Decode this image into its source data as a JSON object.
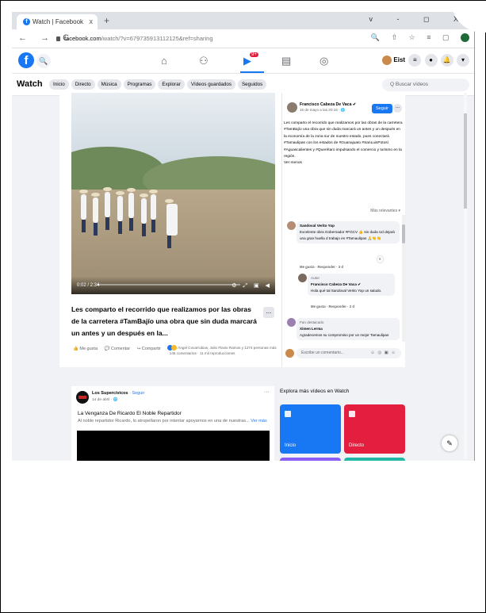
{
  "browser": {
    "tab_title": "Watch | Facebook",
    "tab_close": "x",
    "new_tab": "+",
    "window_controls": "v - ◻ X",
    "nav_buttons": "← → C",
    "url_host": "facebook.com",
    "url_path": "/watch/?v=679735913112125&ref=sharing",
    "extension_icons": "🔍 ⇧ ☆ ≡ ▢"
  },
  "fb_header": {
    "logo": "f",
    "search_icon": "🔍",
    "nav_badge": "9+",
    "profile_name": "Eist",
    "right_icons": [
      "≡",
      "●",
      "🔔",
      "▾"
    ]
  },
  "watch_bar": {
    "title": "Watch",
    "tabs": [
      "Inicio",
      "Directo",
      "Música",
      "Programas",
      "Explorar",
      "Vídeos guardados",
      "Seguidos"
    ],
    "search_placeholder": "Q Buscar vídeos"
  },
  "video": {
    "time": "0:02 / 2:34",
    "controls": "⚙ ⤢ ▣ ◀",
    "progress_fraction": 0.01,
    "title": "Les comparto el recorrido que realizamos por las obras de la carretera #TamBajío una obra que sin duda marcará un antes y un después en la...",
    "more_button": "...",
    "actions": {
      "like": "👍 Me gusta",
      "comment": "💬 Comentar",
      "share": "↪ Compartir"
    },
    "reactions_text": "Ángel Covarrubias, Julio Flavio Ramos y 1274 personas más · 145 comentarios · 11 mil reproducciones"
  },
  "panel": {
    "author_name": "Francisco Cabeza De Vaca ✔",
    "author_date": "16 de mayo a las 20:16 · 🌐",
    "follow_label": "Seguir",
    "dots": "...",
    "description": "Les comparto el recorrido que realizamos por las obras de la carretera #TamBajío una obra que sin duda marcará un antes y un después en la economía de la zona sur de nuestro estado, pues conectará #Tamaulipas con los estados de #Guanajuato #SanLuisPotosí #Aguascalientes y #Querétaro impulsando el comercio y turismo en la región.",
    "see_less": "Ver menos",
    "sort_label": "Más relevantes ▾",
    "comments": [
      {
        "name": "Sandoval Verito Yop",
        "text": "Excelente obra Gobernador #FGCV 👍 sin duda Ud dejará una gran huella d trabajo en #Tamaulipas 🙏👏👏",
        "like": "Me gusta",
        "reply": "Responder",
        "time": "3 d",
        "reaction_count": "8"
      },
      {
        "tag": "Autor",
        "name": "Francisco Cabeza De Vaca ✔",
        "text": "Hola qué tal Sandoval Verito Yop un saludo.",
        "like": "Me gusta",
        "reply": "Responder",
        "time": "2 d"
      },
      {
        "tag": "Fan destacado",
        "name": "Ximen Lerma",
        "text": "Agradecemos su compromiso por un mejor Tamaulipas"
      }
    ],
    "write_placeholder": "Escribe un comentario...",
    "write_icons": "☺ ◎ ▣ ☺"
  },
  "post2": {
    "page_name": "Los Supercívicos",
    "follow": "· Seguir",
    "date": "14 de abril · 🌐",
    "more": "···",
    "title": "La Venganza De Ricardo El Noble Repartidor",
    "text": "Al noble repartidor Ricardo, lo atropellaron por intentar apoyarnos en una de nuestras...",
    "see_more": "Ver más"
  },
  "explore": {
    "heading": "Explora más vídeos en Watch",
    "tiles": [
      {
        "label": "Inicio",
        "color": "#1877f2"
      },
      {
        "label": "Directo",
        "color": "#e41e3f"
      }
    ],
    "next_row_colors": [
      "#8b5cf6",
      "#22b8a6"
    ]
  },
  "edit_fab": "✎"
}
